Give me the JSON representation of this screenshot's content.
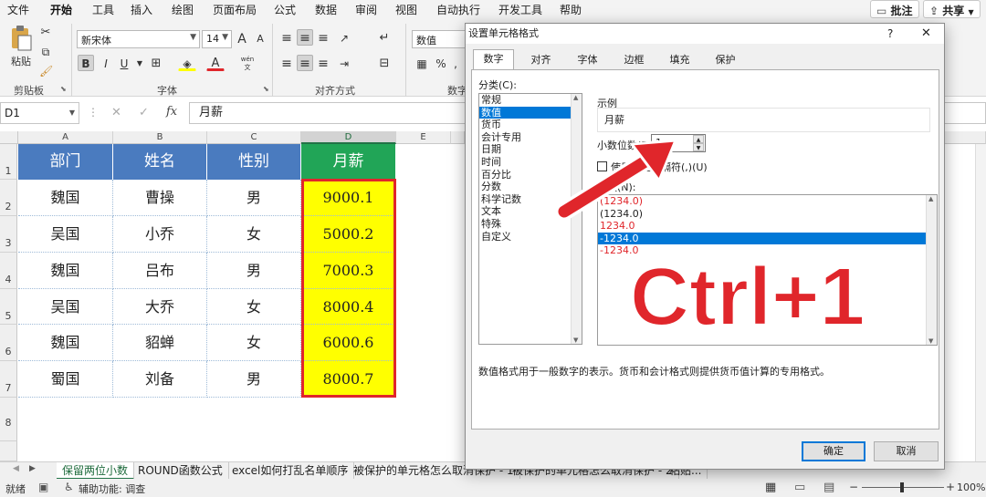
{
  "menu": {
    "items": [
      "文件",
      "开始",
      "工具",
      "插入",
      "绘图",
      "页面布局",
      "公式",
      "数据",
      "审阅",
      "视图",
      "自动执行",
      "开发工具",
      "帮助"
    ],
    "active": "开始",
    "comment_label": "批注",
    "share_label": "共享"
  },
  "ribbon": {
    "paste_label": "粘贴",
    "font_name": "新宋体",
    "font_size": "14",
    "number_format": "数值",
    "groups": {
      "clipboard": "剪贴板",
      "font": "字体",
      "alignment": "对齐方式",
      "number": "数字"
    },
    "bold": "B",
    "italic": "I",
    "underline": "U",
    "wen": "wén",
    "grow_font": "A",
    "shrink_font": "A"
  },
  "formula_bar": {
    "name_box": "D1",
    "fx": "fx",
    "content": "月薪",
    "cancel": "✕",
    "enter": "✓"
  },
  "sheet": {
    "columns": [
      "A",
      "B",
      "C",
      "D",
      "E"
    ],
    "selected_column": "D",
    "rows": [
      "1",
      "2",
      "3",
      "4",
      "5",
      "6",
      "7",
      "8"
    ],
    "header_row": [
      "部门",
      "姓名",
      "性别",
      "月薪"
    ],
    "data": [
      [
        "魏国",
        "曹操",
        "男",
        "9000.1"
      ],
      [
        "吴国",
        "小乔",
        "女",
        "5000.2"
      ],
      [
        "魏国",
        "吕布",
        "男",
        "7000.3"
      ],
      [
        "吴国",
        "大乔",
        "女",
        "8000.4"
      ],
      [
        "魏国",
        "貂蝉",
        "女",
        "6000.6"
      ],
      [
        "蜀国",
        "刘备",
        "男",
        "8000.7"
      ]
    ],
    "colors": {
      "header_blue": "#4a7bbf",
      "header_green": "#21a557",
      "highlight": "#ffff00",
      "selection_border": "#e0262b"
    }
  },
  "sheet_tabs": {
    "items": [
      "保留两位小数",
      "ROUND函数公式",
      "excel如何打乱名单顺序",
      "被保护的单元格怎么取消保护 - 1",
      "被保护的单元格怎么取消保护 - 2",
      "粘贴..."
    ],
    "active": "保留两位小数"
  },
  "status": {
    "ready": "就绪",
    "accessibility": "辅助功能: 调查",
    "zoom": "100%"
  },
  "dialog": {
    "title": "设置单元格格式",
    "help": "?",
    "close": "✕",
    "tabs": [
      "数字",
      "对齐",
      "字体",
      "边框",
      "填充",
      "保护"
    ],
    "active_tab": "数字",
    "category_label": "分类(C):",
    "categories": [
      "常规",
      "数值",
      "货币",
      "会计专用",
      "日期",
      "时间",
      "百分比",
      "分数",
      "科学记数",
      "文本",
      "特殊",
      "自定义"
    ],
    "selected_category": "数值",
    "sample_label": "示例",
    "sample_value": "月薪",
    "decimals_label": "小数位数(D):",
    "decimals_value": "1",
    "thousands_label": "使用千位分隔符(,)(U)",
    "negative_label": "负数(N):",
    "negatives": [
      "(1234.0)",
      "(1234.0)",
      "1234.0",
      "-1234.0",
      "-1234.0"
    ],
    "negative_colors": [
      "#e0262b",
      "#222222",
      "#e0262b",
      "#ffffff",
      "#e0262b"
    ],
    "selected_negative": 3,
    "description": "数值格式用于一般数字的表示。货币和会计格式则提供货币值计算的专用格式。",
    "ok_label": "确定",
    "cancel_label": "取消"
  },
  "overlay": {
    "text": "Ctrl+1",
    "text_color": "#e0262b",
    "arrow_color": "#e0262b"
  }
}
